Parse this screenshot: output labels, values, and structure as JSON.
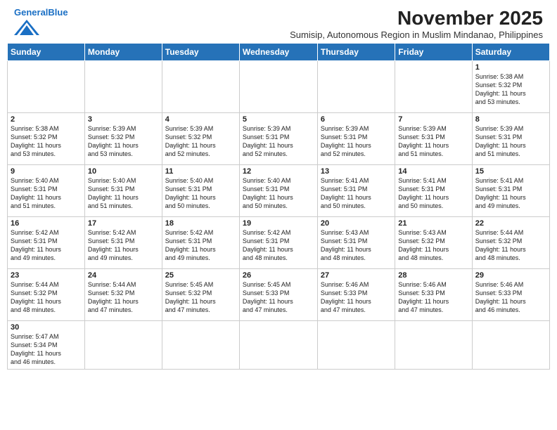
{
  "header": {
    "logo_general": "General",
    "logo_blue": "Blue",
    "month_title": "November 2025",
    "subtitle": "Sumisip, Autonomous Region in Muslim Mindanao, Philippines"
  },
  "days_of_week": [
    "Sunday",
    "Monday",
    "Tuesday",
    "Wednesday",
    "Thursday",
    "Friday",
    "Saturday"
  ],
  "weeks": [
    [
      {
        "day": "",
        "info": ""
      },
      {
        "day": "",
        "info": ""
      },
      {
        "day": "",
        "info": ""
      },
      {
        "day": "",
        "info": ""
      },
      {
        "day": "",
        "info": ""
      },
      {
        "day": "",
        "info": ""
      },
      {
        "day": "1",
        "info": "Sunrise: 5:38 AM\nSunset: 5:32 PM\nDaylight: 11 hours\nand 53 minutes."
      }
    ],
    [
      {
        "day": "2",
        "info": "Sunrise: 5:38 AM\nSunset: 5:32 PM\nDaylight: 11 hours\nand 53 minutes."
      },
      {
        "day": "3",
        "info": "Sunrise: 5:39 AM\nSunset: 5:32 PM\nDaylight: 11 hours\nand 53 minutes."
      },
      {
        "day": "4",
        "info": "Sunrise: 5:39 AM\nSunset: 5:32 PM\nDaylight: 11 hours\nand 52 minutes."
      },
      {
        "day": "5",
        "info": "Sunrise: 5:39 AM\nSunset: 5:31 PM\nDaylight: 11 hours\nand 52 minutes."
      },
      {
        "day": "6",
        "info": "Sunrise: 5:39 AM\nSunset: 5:31 PM\nDaylight: 11 hours\nand 52 minutes."
      },
      {
        "day": "7",
        "info": "Sunrise: 5:39 AM\nSunset: 5:31 PM\nDaylight: 11 hours\nand 51 minutes."
      },
      {
        "day": "8",
        "info": "Sunrise: 5:39 AM\nSunset: 5:31 PM\nDaylight: 11 hours\nand 51 minutes."
      }
    ],
    [
      {
        "day": "9",
        "info": "Sunrise: 5:40 AM\nSunset: 5:31 PM\nDaylight: 11 hours\nand 51 minutes."
      },
      {
        "day": "10",
        "info": "Sunrise: 5:40 AM\nSunset: 5:31 PM\nDaylight: 11 hours\nand 51 minutes."
      },
      {
        "day": "11",
        "info": "Sunrise: 5:40 AM\nSunset: 5:31 PM\nDaylight: 11 hours\nand 50 minutes."
      },
      {
        "day": "12",
        "info": "Sunrise: 5:40 AM\nSunset: 5:31 PM\nDaylight: 11 hours\nand 50 minutes."
      },
      {
        "day": "13",
        "info": "Sunrise: 5:41 AM\nSunset: 5:31 PM\nDaylight: 11 hours\nand 50 minutes."
      },
      {
        "day": "14",
        "info": "Sunrise: 5:41 AM\nSunset: 5:31 PM\nDaylight: 11 hours\nand 50 minutes."
      },
      {
        "day": "15",
        "info": "Sunrise: 5:41 AM\nSunset: 5:31 PM\nDaylight: 11 hours\nand 49 minutes."
      }
    ],
    [
      {
        "day": "16",
        "info": "Sunrise: 5:42 AM\nSunset: 5:31 PM\nDaylight: 11 hours\nand 49 minutes."
      },
      {
        "day": "17",
        "info": "Sunrise: 5:42 AM\nSunset: 5:31 PM\nDaylight: 11 hours\nand 49 minutes."
      },
      {
        "day": "18",
        "info": "Sunrise: 5:42 AM\nSunset: 5:31 PM\nDaylight: 11 hours\nand 49 minutes."
      },
      {
        "day": "19",
        "info": "Sunrise: 5:42 AM\nSunset: 5:31 PM\nDaylight: 11 hours\nand 48 minutes."
      },
      {
        "day": "20",
        "info": "Sunrise: 5:43 AM\nSunset: 5:31 PM\nDaylight: 11 hours\nand 48 minutes."
      },
      {
        "day": "21",
        "info": "Sunrise: 5:43 AM\nSunset: 5:32 PM\nDaylight: 11 hours\nand 48 minutes."
      },
      {
        "day": "22",
        "info": "Sunrise: 5:44 AM\nSunset: 5:32 PM\nDaylight: 11 hours\nand 48 minutes."
      }
    ],
    [
      {
        "day": "23",
        "info": "Sunrise: 5:44 AM\nSunset: 5:32 PM\nDaylight: 11 hours\nand 48 minutes."
      },
      {
        "day": "24",
        "info": "Sunrise: 5:44 AM\nSunset: 5:32 PM\nDaylight: 11 hours\nand 47 minutes."
      },
      {
        "day": "25",
        "info": "Sunrise: 5:45 AM\nSunset: 5:32 PM\nDaylight: 11 hours\nand 47 minutes."
      },
      {
        "day": "26",
        "info": "Sunrise: 5:45 AM\nSunset: 5:33 PM\nDaylight: 11 hours\nand 47 minutes."
      },
      {
        "day": "27",
        "info": "Sunrise: 5:46 AM\nSunset: 5:33 PM\nDaylight: 11 hours\nand 47 minutes."
      },
      {
        "day": "28",
        "info": "Sunrise: 5:46 AM\nSunset: 5:33 PM\nDaylight: 11 hours\nand 47 minutes."
      },
      {
        "day": "29",
        "info": "Sunrise: 5:46 AM\nSunset: 5:33 PM\nDaylight: 11 hours\nand 46 minutes."
      }
    ],
    [
      {
        "day": "30",
        "info": "Sunrise: 5:47 AM\nSunset: 5:34 PM\nDaylight: 11 hours\nand 46 minutes."
      },
      {
        "day": "",
        "info": ""
      },
      {
        "day": "",
        "info": ""
      },
      {
        "day": "",
        "info": ""
      },
      {
        "day": "",
        "info": ""
      },
      {
        "day": "",
        "info": ""
      },
      {
        "day": "",
        "info": ""
      }
    ]
  ]
}
